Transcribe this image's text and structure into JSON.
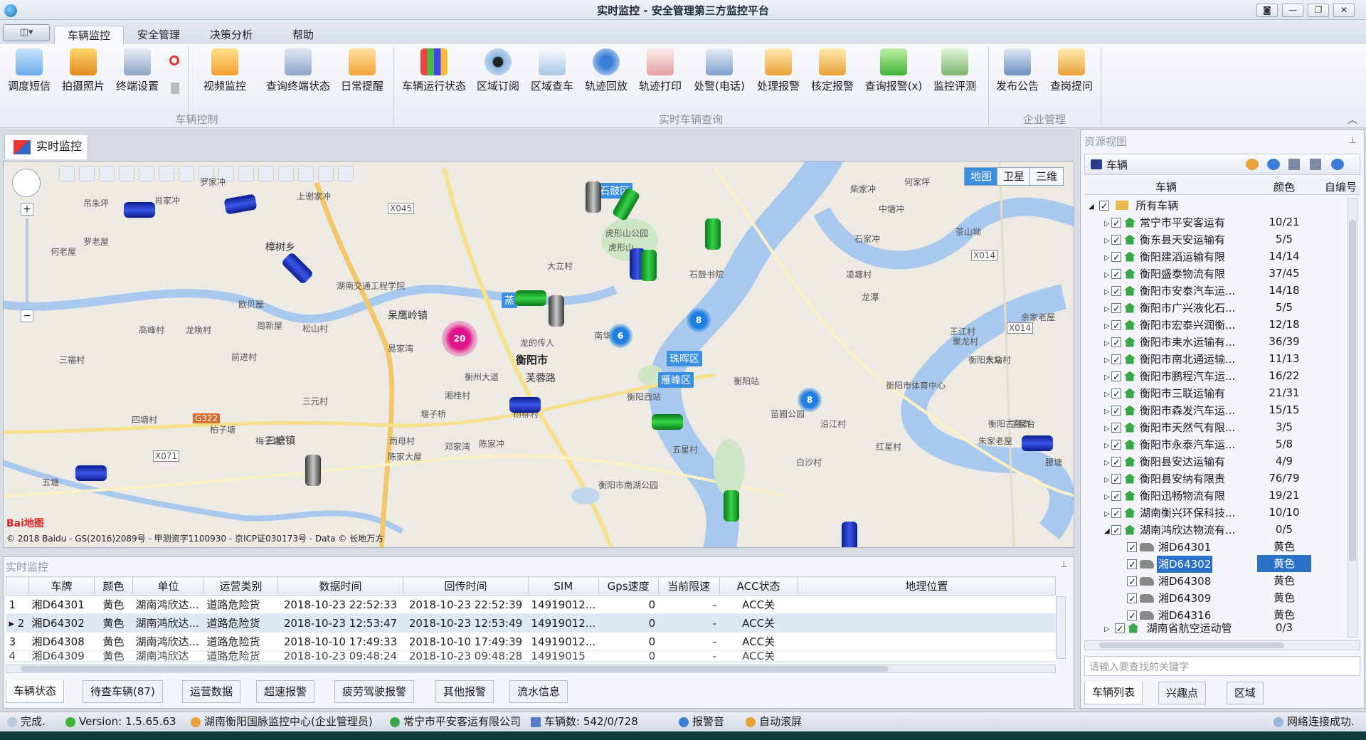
{
  "window": {
    "title": "实时监控 - 安全管理第三方监控平台",
    "buttons": [
      "◙",
      "—",
      "❐",
      "✕"
    ]
  },
  "menu": {
    "app_button": "◫▾",
    "tabs": [
      "车辆监控",
      "安全管理",
      "决策分析",
      "帮助"
    ],
    "active_tab": "车辆监控"
  },
  "ribbon": {
    "groups": [
      {
        "label": "车辆控制",
        "buttons": [
          "调度短信",
          "拍摄照片",
          "终端设置",
          "视频监控",
          "查询终端状态",
          "日常提醒"
        ]
      },
      {
        "label": "实时车辆查询",
        "buttons": [
          "车辆运行状态",
          "区域订阅",
          "区域查车",
          "轨迹回放",
          "轨迹打印",
          "处警(电话)",
          "处理报警",
          "核定报警",
          "查询报警(x)",
          "监控评测"
        ]
      },
      {
        "label": "企业管理",
        "buttons": [
          "发布公告",
          "查岗提问"
        ]
      }
    ]
  },
  "doc_tab": {
    "label": "实时监控"
  },
  "map": {
    "map_types": [
      "地图",
      "卫星",
      "三维"
    ],
    "active_type": "地图",
    "labels": [
      "石鼓区",
      "衡阳市",
      "珠晖区",
      "雁峰区",
      "芙蓉路",
      "呆鹰岭镇",
      "樟树乡",
      "三塘镇",
      "五塘",
      "蒸",
      "湖南交通工程学院",
      "龙的传人",
      "南华大学",
      "衡阳站",
      "衡阳西站",
      "苗圃公园",
      "衡阳市体育中心",
      "衡阳东站",
      "衡阳市南湖公园",
      "衡阳古墓群",
      "石鼓书院",
      "虎形山公园",
      "茶山坳",
      "凌塘村",
      "吊朱坪",
      "肖家冲",
      "罗老屋",
      "何老屋",
      "欧贝屋",
      "周新屋",
      "高峰村",
      "龙唤村",
      "松山村",
      "三福村",
      "前进村",
      "易家湾",
      "四塘村",
      "柏子塘",
      "梅子塘",
      "雨母村",
      "陈家大屋",
      "邓家湾",
      "陈家冲",
      "五星村",
      "白沙村",
      "红星村",
      "丁家台",
      "朱家老屋",
      "腰塘",
      "余家老屋",
      "王江村",
      "龙潭",
      "聚龙村",
      "大众村",
      "湘桂村",
      "堰子桥",
      "杨柳村",
      "沿江村",
      "石家冲",
      "中塘冲",
      "何家坪",
      "柴家冲",
      "上谢家冲",
      "虎形山",
      "大立村",
      "衡州大道",
      "三元村",
      "罗家冲"
    ],
    "road_badges": [
      "X045",
      "X014",
      "X014",
      "G322",
      "X071"
    ],
    "clusters": [
      {
        "count": "20",
        "color": "#e0138c"
      },
      {
        "count": "6",
        "color": "#1f7fe0"
      },
      {
        "count": "8",
        "color": "#1f7fe0"
      },
      {
        "count": "8",
        "color": "#1f7fe0"
      }
    ],
    "baidu_logo": "Bai地图",
    "copyright": "© 2018 Baidu - GS(2016)2089号 - 甲测资字1100930 - 京ICP证030173号 - Data © 长地万方"
  },
  "realtime": {
    "title": "实时监控",
    "columns": [
      "",
      "车牌",
      "颜色",
      "单位",
      "运营类别",
      "数据时间",
      "回传时间",
      "SIM",
      "Gps速度",
      "当前限速",
      "ACC状态",
      "地理位置"
    ],
    "rows": [
      [
        "1",
        "湘D64301",
        "黄色",
        "湖南鸿欣达...",
        "道路危险货",
        "2018-10-23 22:52:33",
        "2018-10-23 22:52:39",
        "14919012...",
        "0",
        "-",
        "ACC关",
        ""
      ],
      [
        "2",
        "湘D64302",
        "黄色",
        "湖南鸿欣达...",
        "道路危险货",
        "2018-10-23 12:53:47",
        "2018-10-23 12:53:49",
        "14919012...",
        "0",
        "-",
        "ACC关",
        ""
      ],
      [
        "3",
        "湘D64308",
        "黄色",
        "湖南鸿欣达...",
        "道路危险货",
        "2018-10-10 17:49:33",
        "2018-10-10 17:49:39",
        "14919012...",
        "0",
        "-",
        "ACC关",
        ""
      ],
      [
        "4",
        "湘D64309",
        "黄色",
        "湖南鸿欣达",
        "道路危险货",
        "2018-10-23 09:48:24",
        "2018-10-23 09:48:28",
        "14919015",
        "0",
        "-",
        "ACC关",
        ""
      ]
    ],
    "tabs": [
      "车辆状态",
      "待查车辆(87)",
      "运营数据",
      "超速报警",
      "疲劳驾驶报警",
      "其他报警",
      "流水信息"
    ]
  },
  "resource": {
    "title": "资源视图",
    "head_label": "车辆",
    "columns": [
      "车辆",
      "颜色",
      "自编号"
    ],
    "root": "所有车辆",
    "companies": [
      {
        "name": "常宁市平安客运有",
        "count": "10/21"
      },
      {
        "name": "衡东县天安运输有",
        "count": "5/5"
      },
      {
        "name": "衡阳建滔运输有限",
        "count": "14/14"
      },
      {
        "name": "衡阳盛泰物流有限",
        "count": "37/45"
      },
      {
        "name": "衡阳市安泰汽车运...",
        "count": "14/18"
      },
      {
        "name": "衡阳市广兴液化石...",
        "count": "5/5"
      },
      {
        "name": "衡阳市宏泰兴润衡...",
        "count": "12/18"
      },
      {
        "name": "衡阳市耒水运输有...",
        "count": "36/39"
      },
      {
        "name": "衡阳市南北通运输...",
        "count": "11/13"
      },
      {
        "name": "衡阳市鹏程汽车运...",
        "count": "16/22"
      },
      {
        "name": "衡阳市三联运输有",
        "count": "21/31"
      },
      {
        "name": "衡阳市森发汽车运...",
        "count": "15/15"
      },
      {
        "name": "衡阳市天然气有限...",
        "count": "3/5"
      },
      {
        "name": "衡阳市永泰汽车运...",
        "count": "5/8"
      },
      {
        "name": "衡阳县安达运输有",
        "count": "4/9"
      },
      {
        "name": "衡阳县安纳有限责",
        "count": "76/79"
      },
      {
        "name": "衡阳迅畅物流有限",
        "count": "19/21"
      },
      {
        "name": "湖南衡兴环保科技...",
        "count": "10/10"
      },
      {
        "name": "湖南鸿欣达物流有...",
        "count": "0/5"
      }
    ],
    "vehicles": [
      {
        "plate": "湘D64301",
        "color": "黄色"
      },
      {
        "plate": "湘D64302",
        "color": "黄色"
      },
      {
        "plate": "湘D64308",
        "color": "黄色"
      },
      {
        "plate": "湘D64309",
        "color": "黄色"
      },
      {
        "plate": "湘D64316",
        "color": "黄色"
      }
    ],
    "last_company": {
      "name": "湖南省航空运动管",
      "count": "0/3"
    },
    "search_placeholder": "请输入要查找的关键字",
    "tabs": [
      "车辆列表",
      "兴趣点",
      "区域"
    ]
  },
  "status": {
    "done": "完成.",
    "version": "Version: 1.5.65.63",
    "center": "湖南衡阳国脉监控中心(企业管理员)",
    "company": "常宁市平安客运有限公司",
    "vehicle_count": "车辆数: 542/0/728",
    "alarm_sound": "报警音",
    "auto_scroll": "自动滚屏",
    "network": "网络连接成功."
  }
}
